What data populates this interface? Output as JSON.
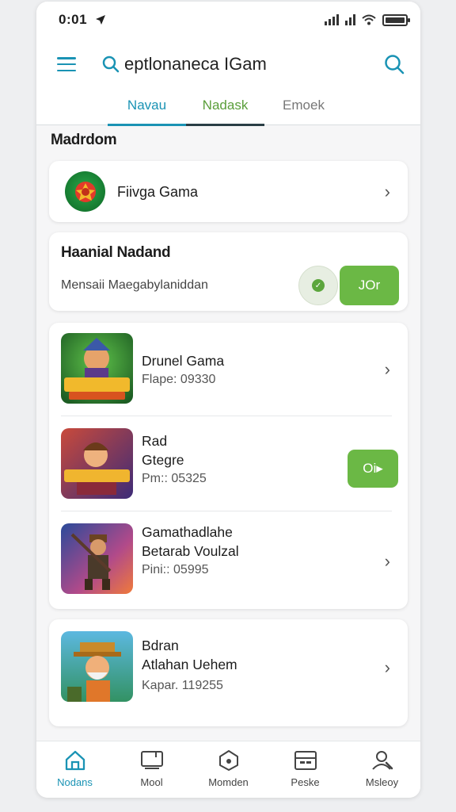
{
  "status_bar": {
    "time": "0:01"
  },
  "app_bar": {
    "search_value": "eptlonaneca IGam"
  },
  "colors": {
    "accent": "#1a93b4",
    "green": "#6bb845",
    "tab_green": "#5a9e3a"
  },
  "tabs": [
    {
      "label": "Navau",
      "color": "#1a93b4",
      "underline": "#1a93b4"
    },
    {
      "label": "Nadask",
      "color": "#5a9e3a",
      "underline": "#2a3e45"
    },
    {
      "label": "Emoek",
      "color": "#777777",
      "underline": ""
    }
  ],
  "section": {
    "title": "Madrdom"
  },
  "featured": {
    "label": "Fiivga Gama",
    "icon": "game-logo-icon"
  },
  "promo": {
    "title": "Haanial Nadand",
    "subtitle": "Mensaii Maegabylaniddan",
    "button_label": "JOr"
  },
  "games": [
    {
      "title": "Drunel Gama",
      "line2": "",
      "meta": "Flape: 09330",
      "has_button": false
    },
    {
      "title": "Rad",
      "line2": "Gtegre",
      "meta": "Pm:: 05325",
      "has_button": true,
      "button_label": "Oi▸"
    },
    {
      "title": "Gamathadlahe",
      "line2": "Betarab Voulzal",
      "meta": "Pini:: 05995",
      "has_button": false
    }
  ],
  "game_card_4": {
    "title": "Bdran",
    "line2": "Atlahan Uehem",
    "meta": "Kapar. 119255"
  },
  "bottom_nav": [
    {
      "label": "Nodans",
      "icon": "home-icon",
      "active": true
    },
    {
      "label": "Mool",
      "icon": "board-icon",
      "active": false
    },
    {
      "label": "Momden",
      "icon": "shield-icon",
      "active": false
    },
    {
      "label": "Peske",
      "icon": "inbox-icon",
      "active": false
    },
    {
      "label": "Msleoy",
      "icon": "profile-icon",
      "active": false
    }
  ]
}
